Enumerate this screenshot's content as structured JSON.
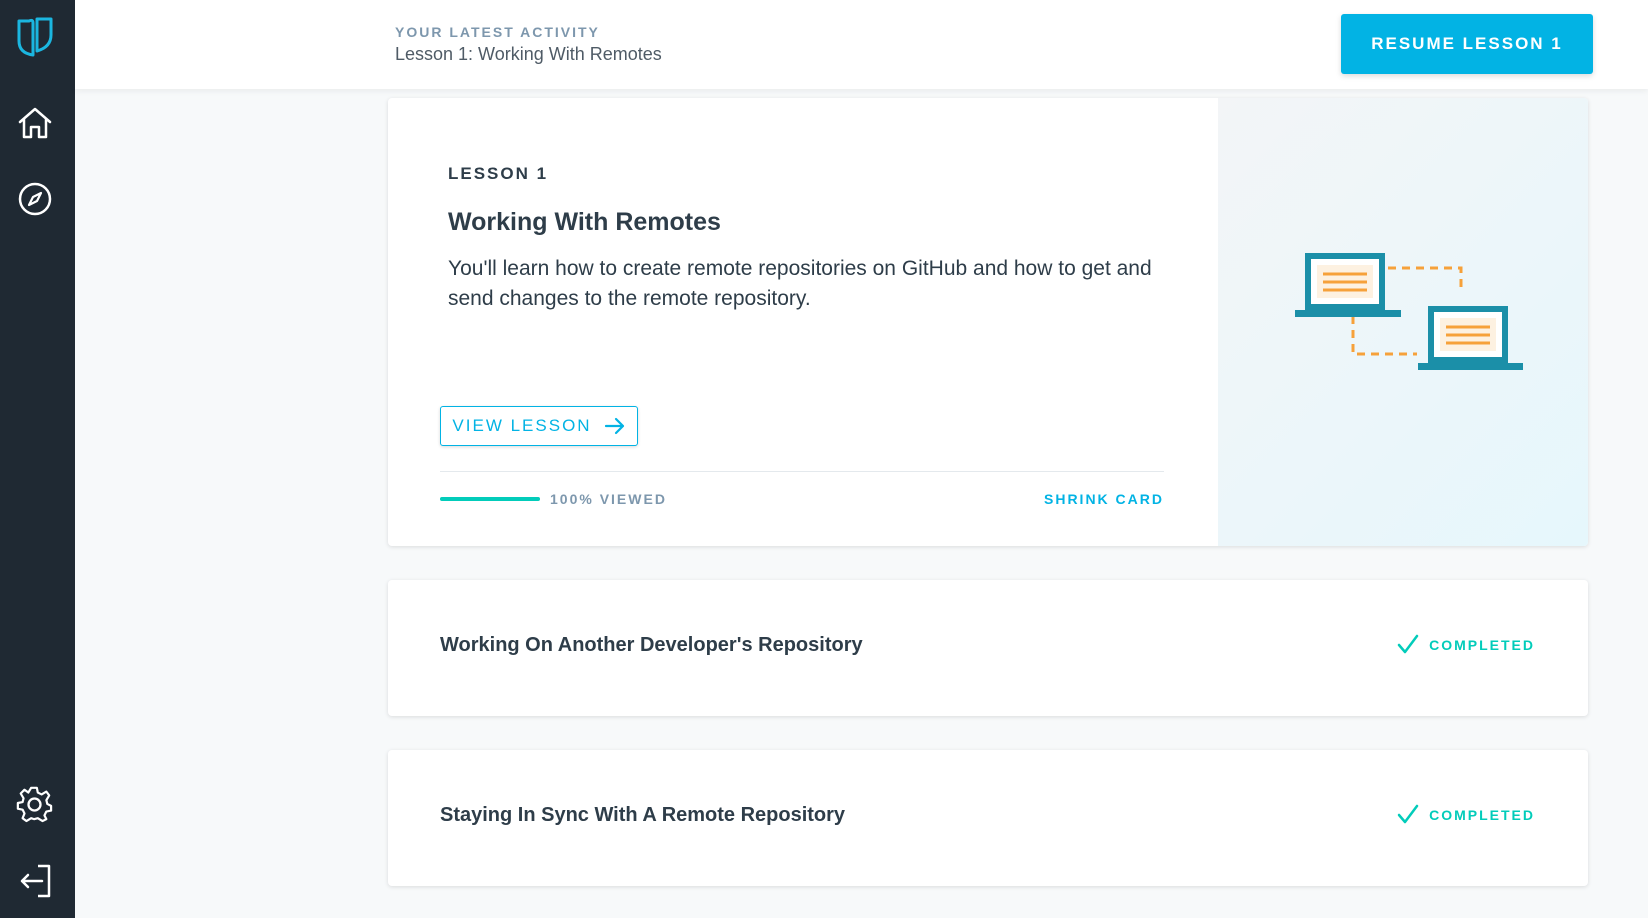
{
  "sidebar": {
    "items": [
      {
        "name": "udacity-logo-icon"
      },
      {
        "name": "home-icon"
      },
      {
        "name": "compass-icon"
      },
      {
        "name": "gear-icon"
      },
      {
        "name": "logout-icon"
      }
    ]
  },
  "header": {
    "kicker": "YOUR LATEST ACTIVITY",
    "title": "Lesson 1: Working With Remotes",
    "resume_label": "RESUME LESSON 1"
  },
  "lesson_card": {
    "kicker": "LESSON 1",
    "title": "Working With Remotes",
    "description": "You'll learn how to create remote repositories on GitHub and how to get and send changes to the remote repository.",
    "view_label": "VIEW LESSON",
    "progress_percent": 100,
    "progress_label": "100% VIEWED",
    "shrink_label": "SHRINK CARD",
    "illustration": "two-laptops-icon"
  },
  "lessons": [
    {
      "title": "Working On Another Developer's Repository",
      "status": "COMPLETED"
    },
    {
      "title": "Staying In Sync With A Remote Repository",
      "status": "COMPLETED"
    }
  ],
  "colors": {
    "sidebar": "#1f2933",
    "accent": "#02b3e4",
    "success": "#02ccba",
    "illustration_teal": "#1b8fa8",
    "illustration_orange": "#f6a13a"
  }
}
